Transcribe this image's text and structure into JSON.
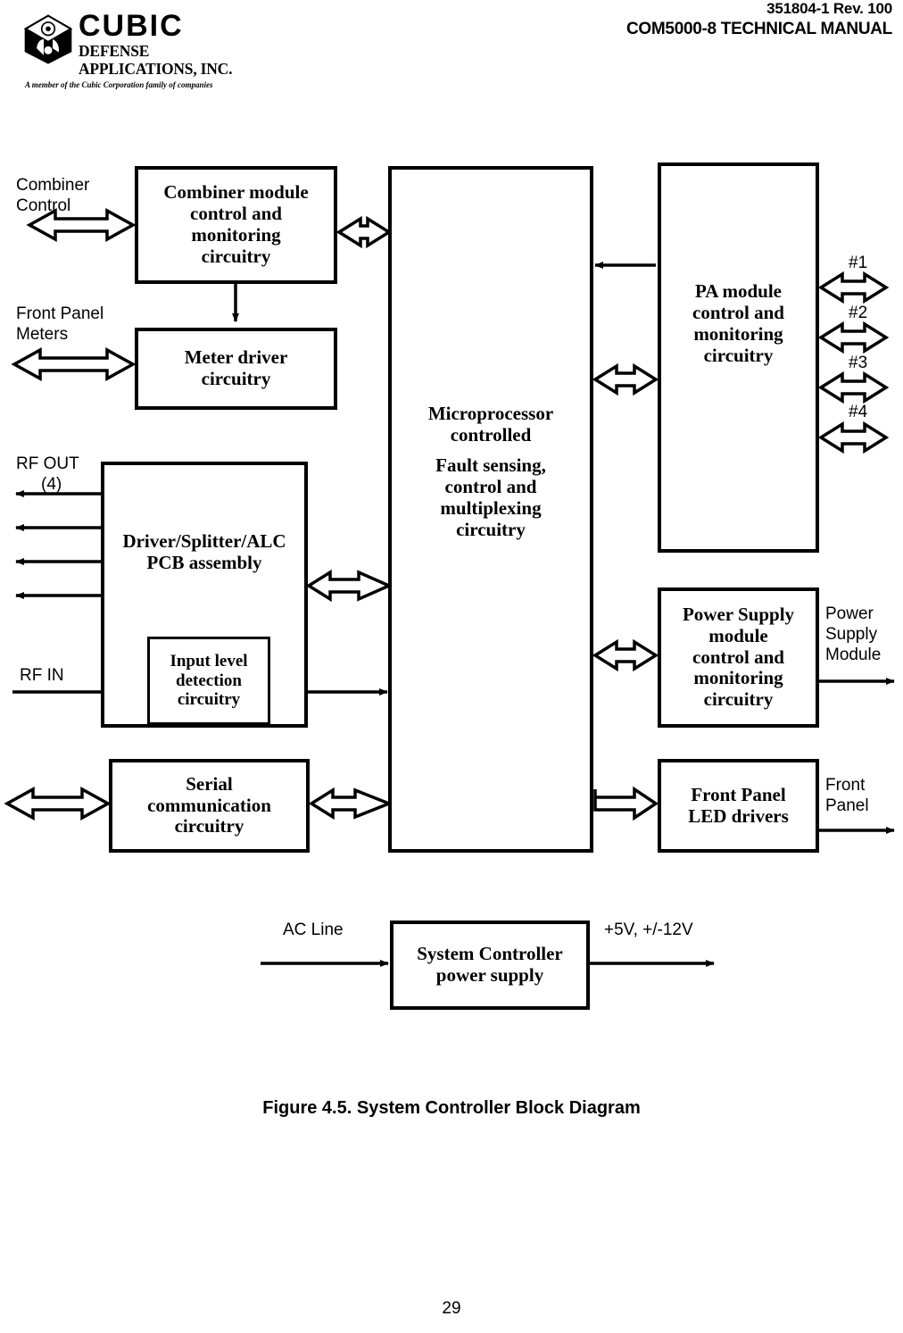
{
  "header": {
    "doc_id": "351804-1 Rev. 100",
    "doc_title": "COM5000-8 TECHNICAL MANUAL",
    "logo": {
      "name": "CUBIC",
      "subtitle": "DEFENSE APPLICATIONS, INC.",
      "tagline": "A member of the Cubic Corporation family of companies"
    }
  },
  "diagram": {
    "boxes": {
      "combiner": {
        "l1": "Combiner module",
        "l2": "control and",
        "l3": "monitoring",
        "l4": "circuitry"
      },
      "meter": {
        "l1": "Meter driver",
        "l2": "circuitry"
      },
      "driver": {
        "l1": "Driver/Splitter/ALC",
        "l2": "PCB assembly"
      },
      "input_level": {
        "l1": "Input level",
        "l2": "detection",
        "l3": "circuitry"
      },
      "serial": {
        "l1": "Serial",
        "l2": "communication",
        "l3": "circuitry"
      },
      "micro": {
        "l1": "Microprocessor",
        "l2": "controlled",
        "l3": "Fault sensing,",
        "l4": "control and",
        "l5": "multiplexing",
        "l6": "circuitry"
      },
      "pa": {
        "l1": "PA module",
        "l2": "control and",
        "l3": "monitoring",
        "l4": "circuitry"
      },
      "psu": {
        "l1": "Power Supply",
        "l2": "module",
        "l3": "control and",
        "l4": "monitoring",
        "l5": "circuitry"
      },
      "fp_led": {
        "l1": "Front Panel",
        "l2": "LED drivers"
      },
      "sys_power": {
        "l1": "System Controller",
        "l2": "power supply"
      }
    },
    "labels": {
      "combiner_control": "Combiner\nControl",
      "front_panel_meters": "Front Panel\nMeters",
      "rf_out": "RF OUT",
      "rf_out_qty": "(4)",
      "rf_in": "RF IN",
      "pa_1": "#1",
      "pa_2": "#2",
      "pa_3": "#3",
      "pa_4": "#4",
      "power_supply_module": "Power\nSupply\nModule",
      "front_panel": "Front\nPanel",
      "ac_line": "AC Line",
      "dc_out": "+5V, +/-12V"
    }
  },
  "figure": {
    "caption": "Figure 4.5.  System Controller Block Diagram"
  },
  "footer": {
    "page_number": "29"
  },
  "colors": {
    "ink": "#000000",
    "paper": "#ffffff"
  }
}
